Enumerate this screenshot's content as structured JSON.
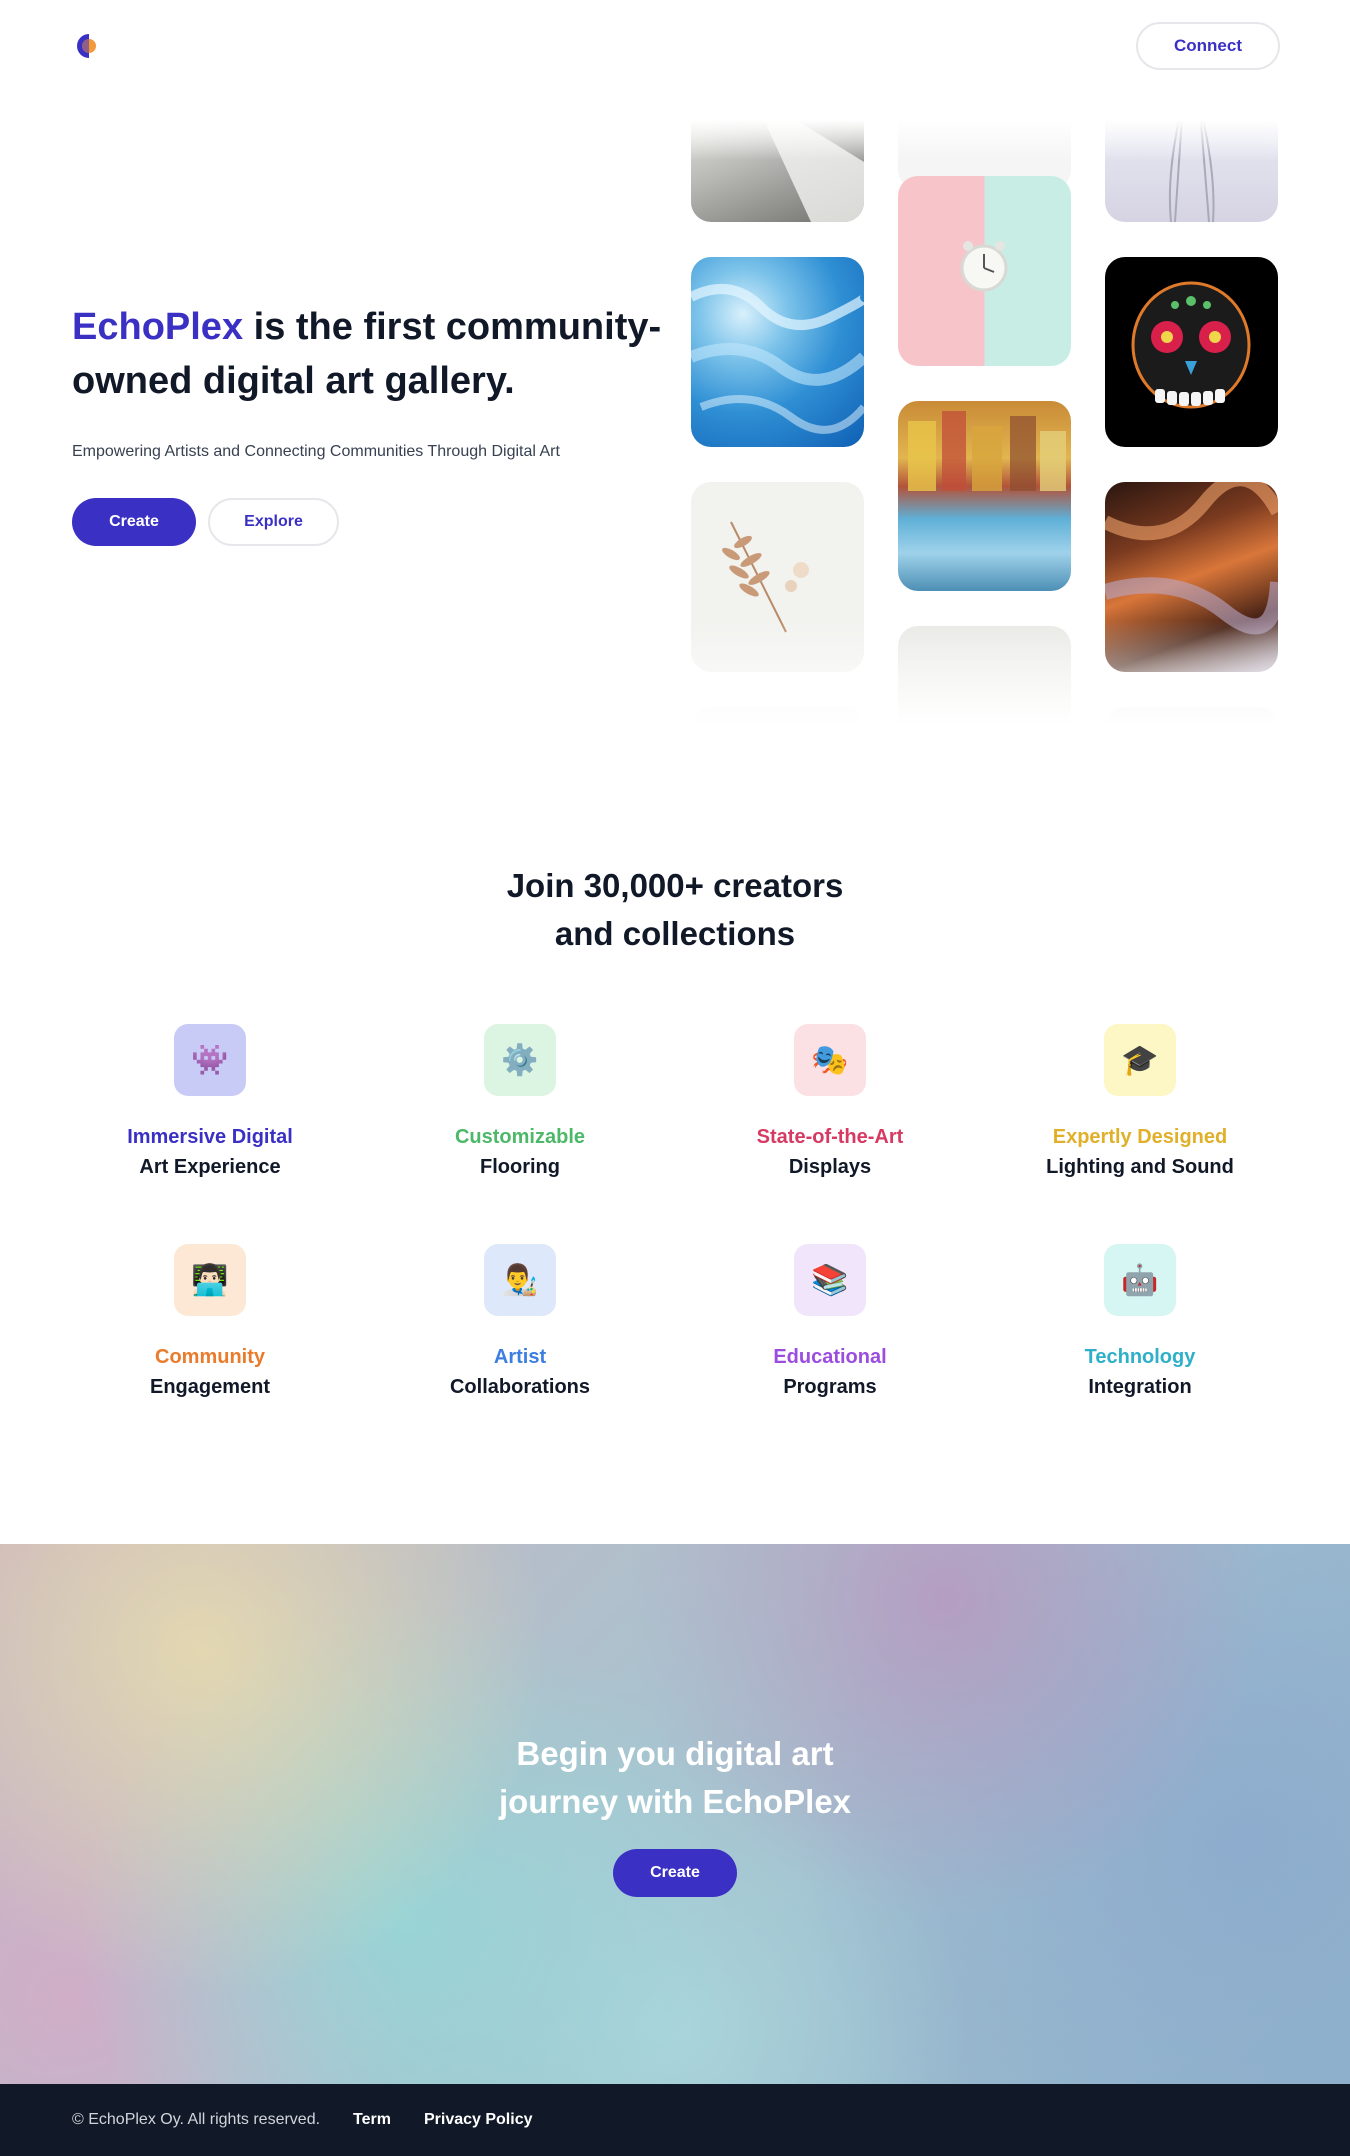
{
  "header": {
    "logo_icon": "half-circle-logo-icon",
    "connect_label": "Connect"
  },
  "hero": {
    "brand": "EchoPlex",
    "title_rest": "is the first community-owned digital art gallery.",
    "subtitle": "Empowering Artists and Connecting Communities Through Digital Art",
    "create_label": "Create",
    "explore_label": "Explore"
  },
  "gallery": {
    "tiles": [
      {
        "icon": "abstract-gray-image"
      },
      {
        "icon": "blue-texture-image"
      },
      {
        "icon": "dried-flowers-image"
      },
      {
        "icon": "alarm-clock-image"
      },
      {
        "icon": "colorful-reflection-image"
      },
      {
        "icon": "cloud-image"
      },
      {
        "icon": "glass-vase-image"
      },
      {
        "icon": "sugar-skull-image"
      },
      {
        "icon": "canyon-image"
      }
    ]
  },
  "features": {
    "title": "Join 30,000+ creators and collections",
    "items": [
      {
        "line1": "Immersive Digital",
        "line2": "Art Experience",
        "emoji": "👾",
        "color": "#3b30c4",
        "bg": "#c9cbf7",
        "icon": "alien-monster-icon"
      },
      {
        "line1": "Customizable",
        "line2": "Flooring",
        "emoji": "⚙️",
        "color": "#4cb868",
        "bg": "#dcf5e3",
        "icon": "gear-icon"
      },
      {
        "line1": "State-of-the-Art",
        "line2": "Displays",
        "emoji": "🎭",
        "color": "#d63a62",
        "bg": "#fbe0e4",
        "icon": "theater-masks-icon"
      },
      {
        "line1": "Expertly Designed",
        "line2": "Lighting and Sound",
        "emoji": "🎓",
        "color": "#e0b02a",
        "bg": "#fdf6c5",
        "icon": "graduation-cap-icon"
      },
      {
        "line1": "Community",
        "line2": "Engagement",
        "emoji": "👨🏻‍💻",
        "color": "#ea7b2c",
        "bg": "#fde8d5",
        "icon": "technologist-icon"
      },
      {
        "line1": "Artist",
        "line2": "Collaborations",
        "emoji": "👨‍🎨",
        "color": "#3d7fe0",
        "bg": "#dde8fb",
        "icon": "artist-icon"
      },
      {
        "line1": "Educational",
        "line2": "Programs",
        "emoji": "📚",
        "color": "#9b4de0",
        "bg": "#f0e5fb",
        "icon": "books-icon"
      },
      {
        "line1": "Technology",
        "line2": "Integration",
        "emoji": "🤖",
        "color": "#2fb0c9",
        "bg": "#d5f6f3",
        "icon": "robot-icon"
      }
    ]
  },
  "cta": {
    "title": "Begin you digital art journey with EchoPlex",
    "create_label": "Create"
  },
  "footer": {
    "copyright": "© EchoPlex Oy. All rights reserved.",
    "term_label": "Term",
    "privacy_label": "Privacy Policy"
  }
}
